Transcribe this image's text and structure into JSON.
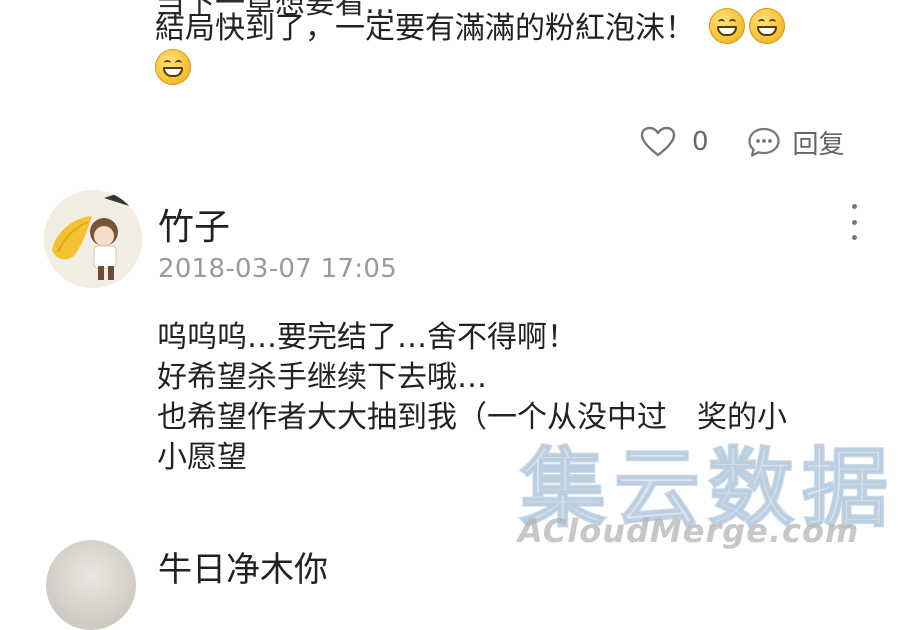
{
  "previous_comment": {
    "cut_line": "当下一章想要看…",
    "line": "結局快到了，一定要有滿滿的粉紅泡沫！",
    "like_count": "0",
    "reply_label": "回复"
  },
  "comment": {
    "username": "竹子",
    "timestamp": "2018-03-07 17:05",
    "lines": [
      "呜呜呜…要完结了…舍不得啊！",
      "好希望杀手继续下去哦…",
      "也希望作者大大抽到我（一个从没中过　奖的小",
      "小愿望"
    ]
  },
  "next_comment": {
    "username": "牛日净木你"
  },
  "watermark": {
    "cjk": "集云数据",
    "latin": "ACloudMerge.com"
  },
  "icons": {
    "like": "heart-outline-icon",
    "reply": "speech-bubble-icon",
    "more": "vertical-ellipsis-icon",
    "emoji": "grinning-face-icon"
  }
}
